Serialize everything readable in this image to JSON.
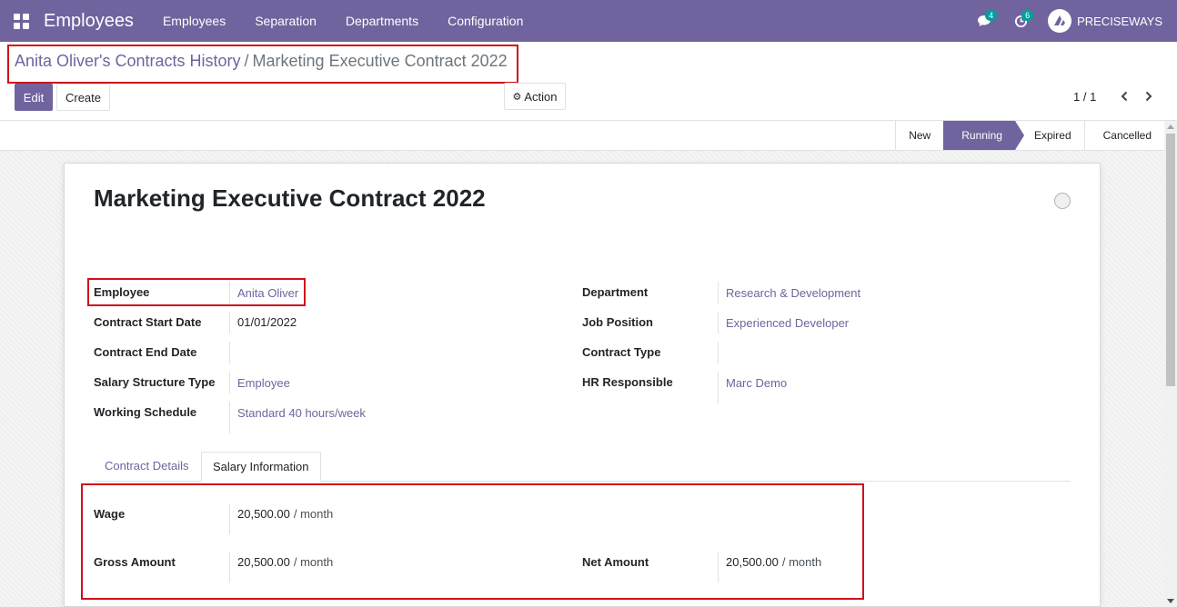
{
  "topnav": {
    "brand": "Employees",
    "menu": [
      "Employees",
      "Separation",
      "Departments",
      "Configuration"
    ],
    "messages_count": "4",
    "activities_count": "6",
    "company": "PRECISEWAYS"
  },
  "breadcrumb": {
    "parent": "Anita Oliver's Contracts History",
    "separator": "/",
    "current": "Marketing Executive Contract 2022"
  },
  "buttons": {
    "edit": "Edit",
    "create": "Create",
    "action": "Action"
  },
  "pager": {
    "value": "1 / 1"
  },
  "stages": [
    "New",
    "Running",
    "Expired",
    "Cancelled"
  ],
  "active_stage": "Running",
  "form": {
    "title": "Marketing Executive Contract 2022",
    "left": [
      {
        "label": "Employee",
        "value": "Anita Oliver"
      },
      {
        "label": "Contract Start Date",
        "value": "01/01/2022"
      },
      {
        "label": "Contract End Date",
        "value": ""
      },
      {
        "label": "Salary Structure Type",
        "value": "Employee"
      },
      {
        "label": "Working Schedule",
        "value": "Standard 40 hours/week"
      }
    ],
    "right": [
      {
        "label": "Department",
        "value": "Research & Development"
      },
      {
        "label": "Job Position",
        "value": "Experienced Developer"
      },
      {
        "label": "Contract Type",
        "value": ""
      },
      {
        "label": "HR Responsible",
        "value": "Marc Demo"
      }
    ]
  },
  "tabs": [
    "Contract Details",
    "Salary Information"
  ],
  "active_tab": "Salary Information",
  "salary": {
    "wage": {
      "label": "Wage",
      "value": "20,500.00",
      "unit": "/ month"
    },
    "gross": {
      "label": "Gross Amount",
      "value": "20,500.00",
      "unit": "/ month"
    },
    "net": {
      "label": "Net Amount",
      "value": "20,500.00",
      "unit": "/ month"
    }
  },
  "colors": {
    "brand": "#71639e",
    "highlight": "#d0101b",
    "badge": "#00a09d"
  }
}
